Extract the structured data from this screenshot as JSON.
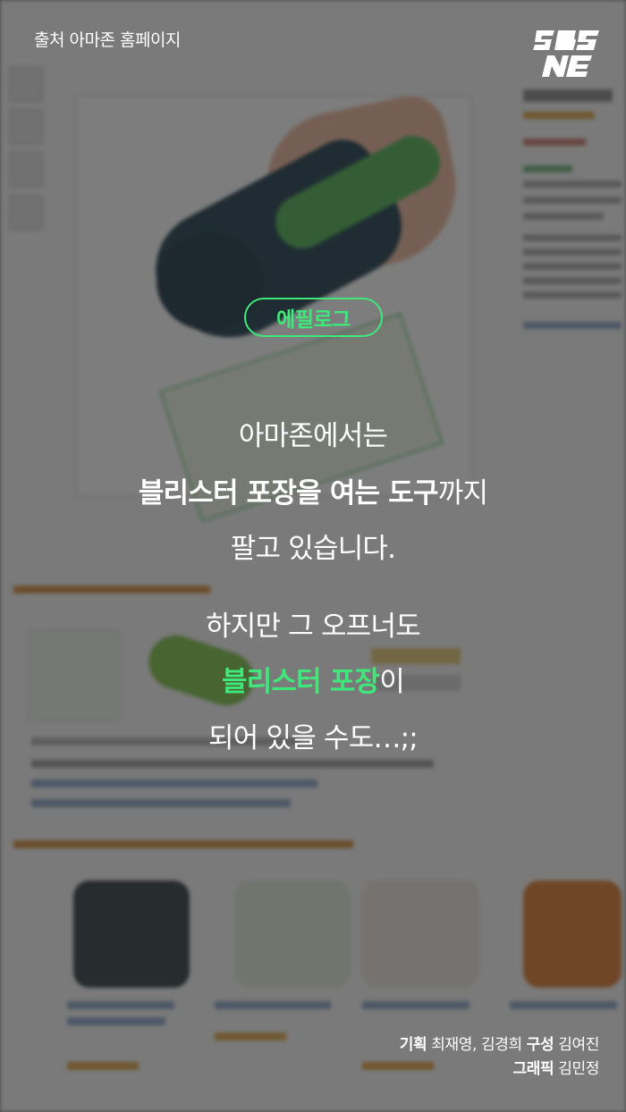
{
  "source_caption": "출처 아마존 홈페이지",
  "tag": "에필로그",
  "lines": {
    "l1": "아마존에서는",
    "l2_bold": "블리스터 포장을 여는 도구",
    "l2_rest": "까지",
    "l3": "팔고 있습니다.",
    "l4": "하지만 그 오프너도",
    "l5_green": "블리스터 포장",
    "l5_rest": "이",
    "l6": "되어 있을 수도…;;"
  },
  "credits": {
    "plan_role": "기획",
    "plan_names": "최재영, 김경희",
    "compose_role": "구성",
    "compose_name": "김여진",
    "graphic_role": "그래픽",
    "graphic_name": "김민정"
  },
  "colors": {
    "accent_green": "#3ee87a",
    "overlay": "rgba(35,35,35,0.58)",
    "text": "#ffffff"
  },
  "logo_icon": "sbs-news-logo"
}
